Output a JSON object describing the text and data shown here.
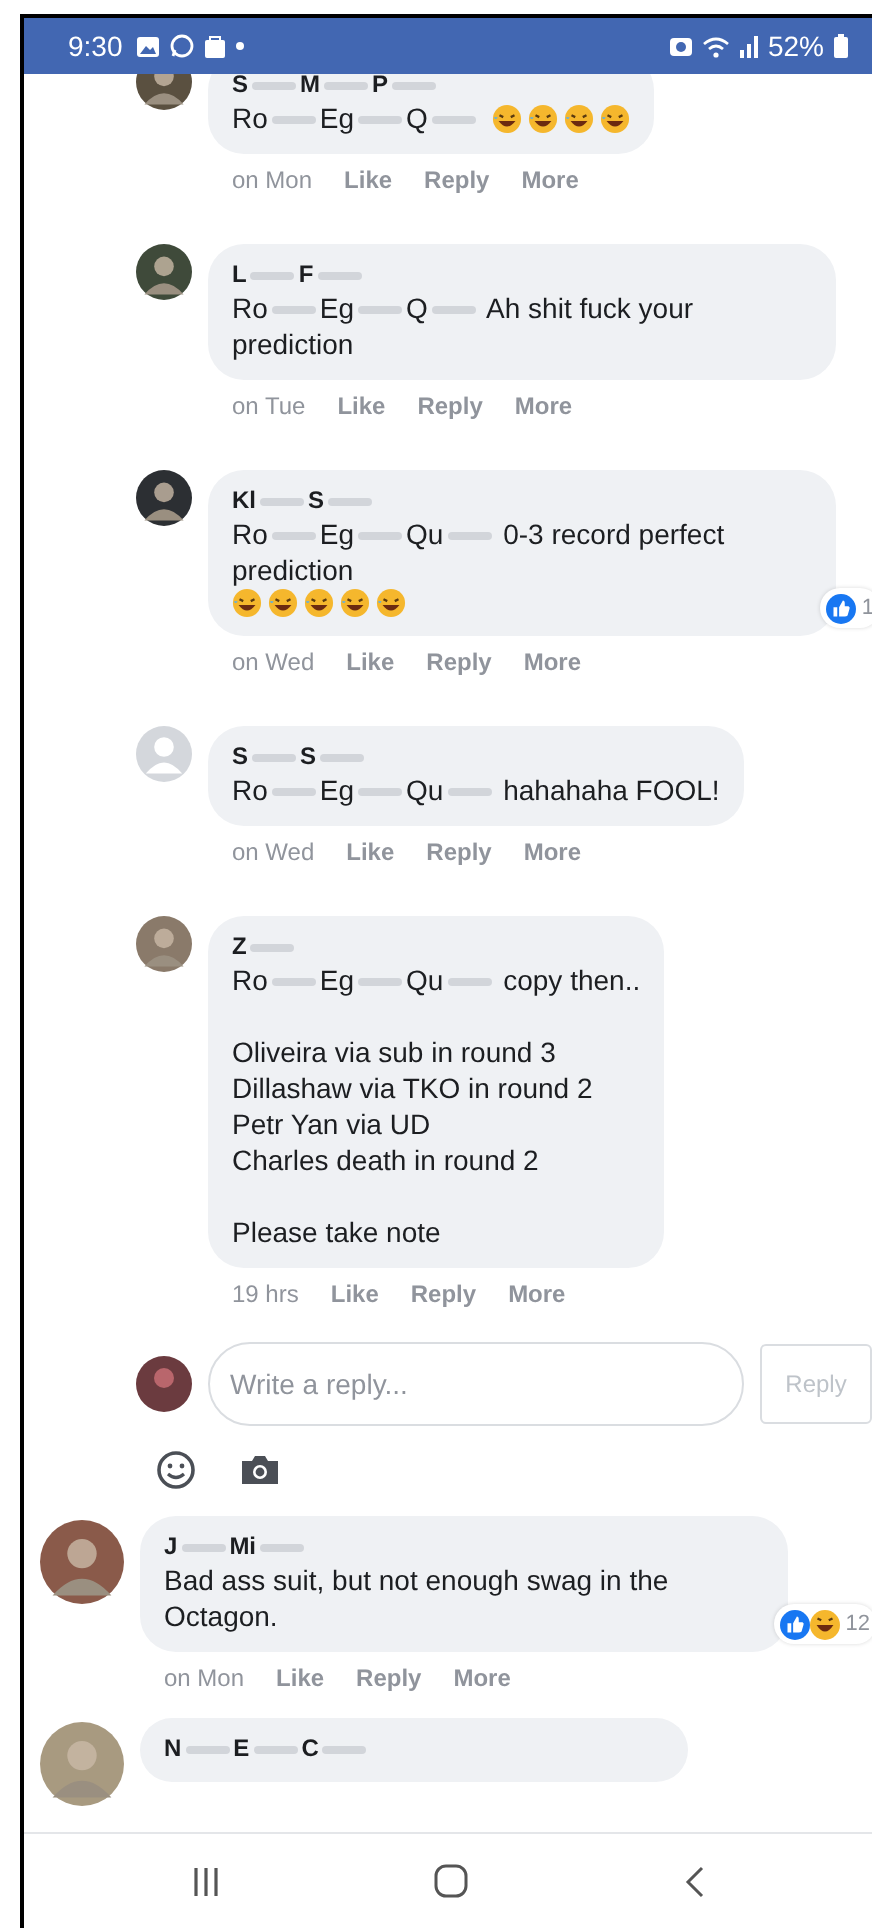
{
  "status_bar": {
    "time": "9:30",
    "battery": "52%"
  },
  "comments": [
    {
      "kind": "reply",
      "name": [
        "S",
        "M",
        "P"
      ],
      "mention": [
        "Ro",
        "Eg",
        "Q"
      ],
      "emojis": [
        {
          "kind": "laugh"
        },
        {
          "kind": "laugh"
        },
        {
          "kind": "laugh"
        },
        {
          "kind": "laugh"
        }
      ],
      "time": "on Mon",
      "actions": [
        "Like",
        "Reply",
        "More"
      ]
    },
    {
      "kind": "reply",
      "name": [
        "L",
        "F"
      ],
      "mention": [
        "Ro",
        "Eg",
        "Q"
      ],
      "text": "Ah shit fuck your prediction",
      "time": "on Tue",
      "actions": [
        "Like",
        "Reply",
        "More"
      ]
    },
    {
      "kind": "reply",
      "name": [
        "Kl",
        "S"
      ],
      "mention": [
        "Ro",
        "Eg",
        "Qu"
      ],
      "text": "0-3 record perfect prediction",
      "emojis": [
        {
          "kind": "laugh"
        },
        {
          "kind": "laugh"
        },
        {
          "kind": "laugh"
        },
        {
          "kind": "laugh"
        },
        {
          "kind": "laugh"
        }
      ],
      "reactions": {
        "icons": [
          {
            "kind": "like"
          }
        ],
        "count": "1"
      },
      "time": "on Wed",
      "actions": [
        "Like",
        "Reply",
        "More"
      ]
    },
    {
      "kind": "reply",
      "default_avatar": true,
      "name": [
        "S",
        "S"
      ],
      "mention": [
        "Ro",
        "Eg",
        "Qu"
      ],
      "text": "hahahaha FOOL!",
      "time": "on Wed",
      "actions": [
        "Like",
        "Reply",
        "More"
      ]
    },
    {
      "kind": "reply",
      "name": [
        "Z"
      ],
      "mention": [
        "Ro",
        "Eg",
        "Qu"
      ],
      "text": "copy then..",
      "paragraphs": [
        [
          "Oliveira via sub in round 3",
          "Dillashaw via TKO in round 2",
          "Petr Yan via UD",
          "Charles death in round 2"
        ],
        [
          "Please take note"
        ]
      ],
      "time": "19 hrs",
      "actions": [
        "Like",
        "Reply",
        "More"
      ]
    },
    {
      "kind": "reply_box",
      "placeholder": "Write a reply...",
      "button": "Reply"
    },
    {
      "kind": "comment",
      "name": [
        "J",
        "Mi"
      ],
      "text": "Bad ass suit, but not enough swag in the Octagon.",
      "reactions": {
        "icons": [
          {
            "kind": "like"
          },
          {
            "kind": "haha"
          }
        ],
        "count": "12"
      },
      "time": "on Mon",
      "actions": [
        "Like",
        "Reply",
        "More"
      ]
    },
    {
      "kind": "comment",
      "name": [
        "N",
        "E",
        "C"
      ]
    }
  ]
}
